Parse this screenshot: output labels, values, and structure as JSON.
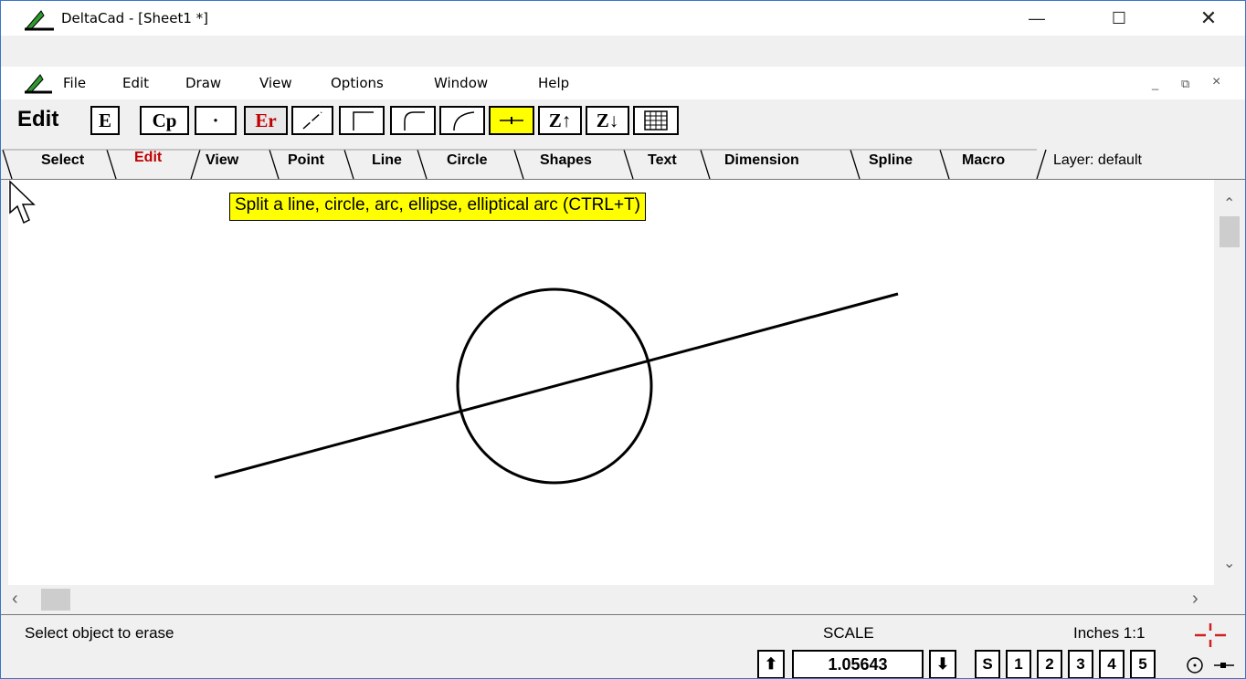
{
  "window": {
    "title": "DeltaCad - [Sheet1 *]",
    "minimize": "—",
    "maximize": "☐",
    "close": "✕"
  },
  "menu": {
    "items": [
      "File",
      "Edit",
      "Draw",
      "View",
      "Options",
      "Window",
      "Help"
    ],
    "mdi_minimize": "_",
    "mdi_restore": "⧉",
    "mdi_close": "×"
  },
  "toolbar": {
    "title": "Edit",
    "buttons": [
      {
        "label": "E",
        "icon": "edit-icon"
      },
      {
        "label": "Cp",
        "icon": "copy-icon"
      },
      {
        "label": "·",
        "icon": "point-icon"
      },
      {
        "label": "Er",
        "icon": "erase-icon"
      },
      {
        "label": "",
        "icon": "trim-line-icon"
      },
      {
        "label": "",
        "icon": "corner-icon"
      },
      {
        "label": "",
        "icon": "fillet-icon"
      },
      {
        "label": "",
        "icon": "chamfer-arc-icon"
      },
      {
        "label": "",
        "icon": "split-icon"
      },
      {
        "label": "Z↑",
        "icon": "bring-to-front-icon"
      },
      {
        "label": "Z↓",
        "icon": "send-to-back-icon"
      },
      {
        "label": "",
        "icon": "array-icon"
      }
    ]
  },
  "tabs": {
    "items": [
      "Select",
      "Edit",
      "View",
      "Point",
      "Line",
      "Circle",
      "Shapes",
      "Text",
      "Dimension",
      "Spline",
      "Macro"
    ],
    "active": "Edit",
    "layer": "Layer: default"
  },
  "canvas": {
    "tooltip": "Split a line, circle, arc, ellipse, elliptical arc (CTRL+T)"
  },
  "statusbar": {
    "message": "Select object to erase",
    "scale_label": "SCALE",
    "scale_value": "1.05643",
    "units": "Inches 1:1",
    "scale_up": "⬆",
    "scale_down": "⬇",
    "view_buttons": [
      "S",
      "1",
      "2",
      "3",
      "4",
      "5"
    ]
  },
  "colors": {
    "active_tab": "#c00000",
    "tooltip_bg": "#ffff00",
    "erase_text": "#c00000"
  }
}
